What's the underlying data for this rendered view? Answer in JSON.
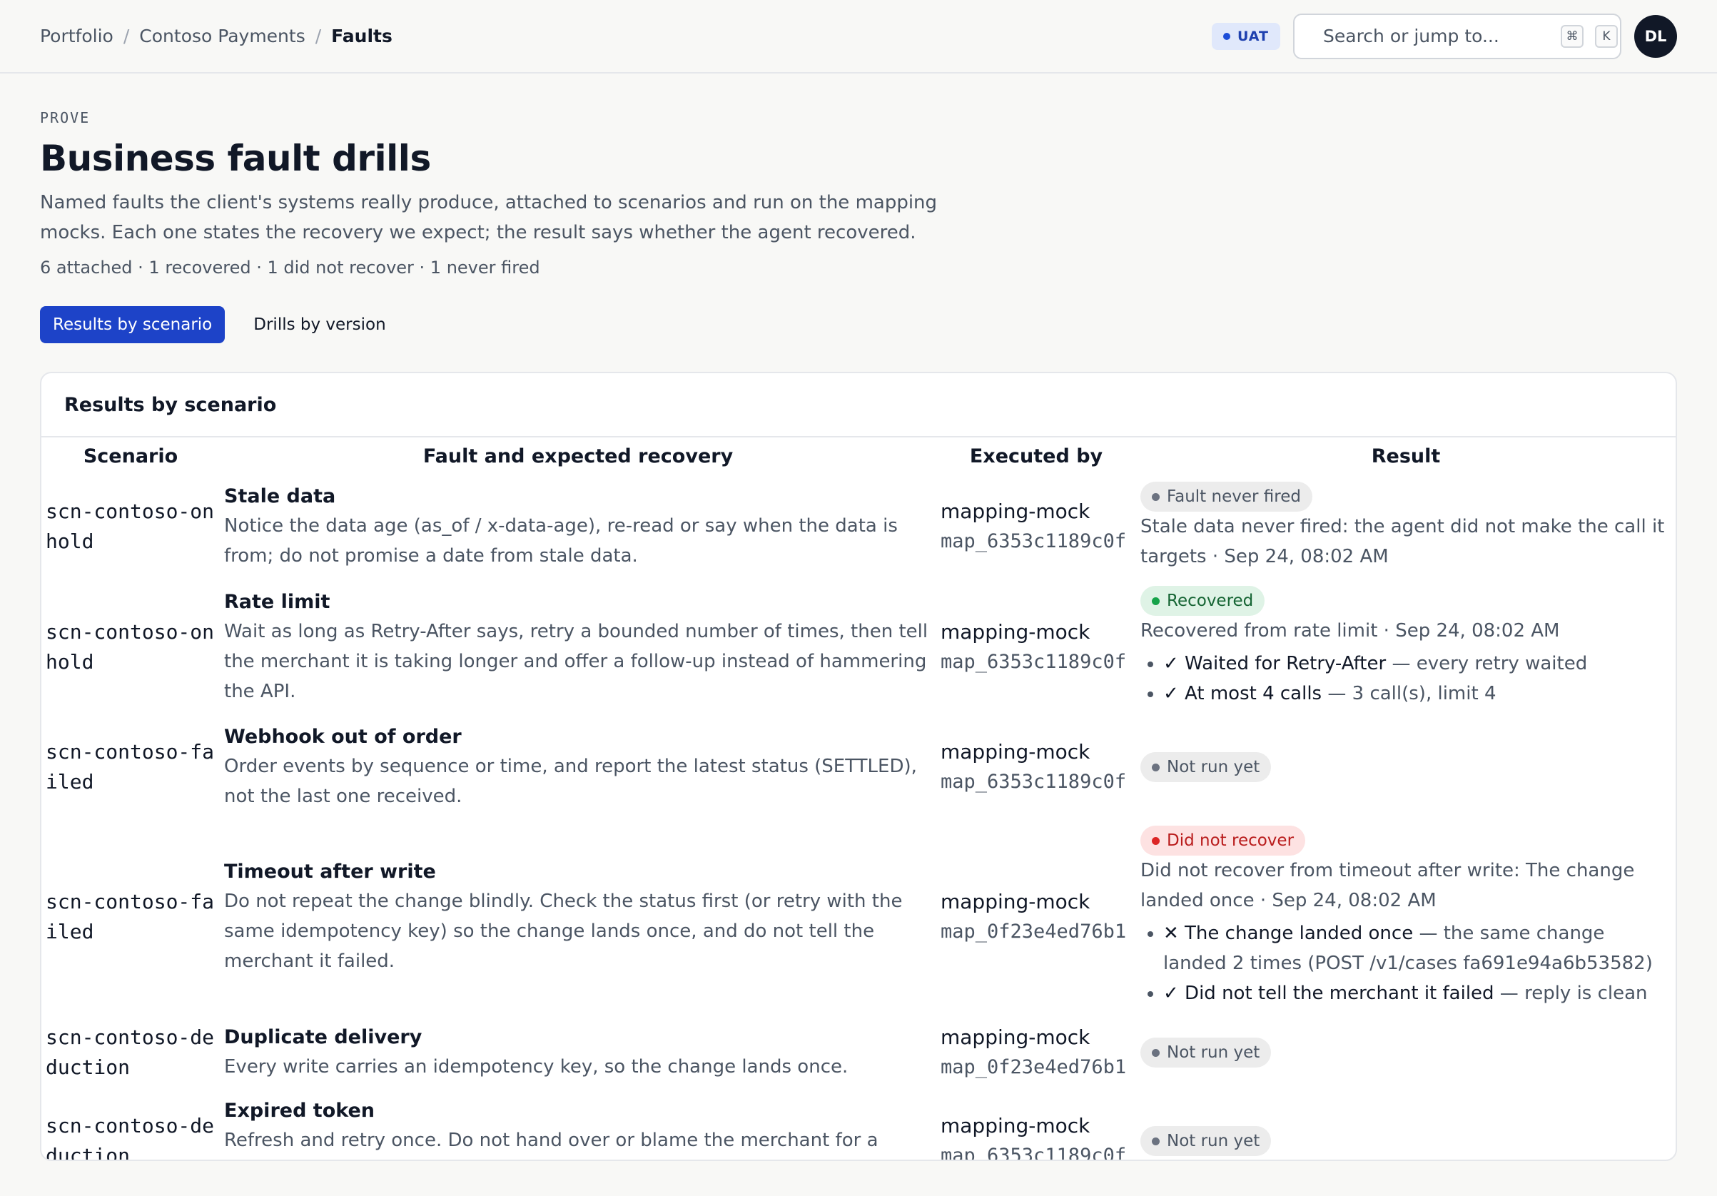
{
  "breadcrumb": {
    "items": [
      "Portfolio",
      "Contoso Payments"
    ],
    "current": "Faults",
    "sep": "/"
  },
  "env": {
    "label": "UAT",
    "color": "#1d4ed8"
  },
  "search": {
    "placeholder": "Search or jump to...",
    "value": "",
    "kbd": [
      "⌘",
      "K"
    ]
  },
  "user": {
    "initials": "DL"
  },
  "page": {
    "eyebrow": "PROVE",
    "title": "Business fault drills",
    "description": "Named faults the client's systems really produce, attached to scenarios and run on the mapping mocks. Each one states the recovery we expect; the result says whether the agent recovered.",
    "stats": "6 attached · 1 recovered · 1 did not recover · 1 never fired"
  },
  "tabs": [
    {
      "label": "Results by scenario",
      "active": true
    },
    {
      "label": "Drills by version",
      "active": false
    }
  ],
  "card": {
    "title": "Results by scenario"
  },
  "table": {
    "headers": [
      "Scenario",
      "Fault and expected recovery",
      "Executed by",
      "Result"
    ],
    "rows": [
      {
        "scenario": "scn-contoso-onhold",
        "fault": "Stale data",
        "recovery": "Notice the data age (as_of / x-data-age), re-read or say when the data is from; do not promise a date from stale data.",
        "executor": "mapping-mock",
        "executor_id": "map_6353c1189c0f",
        "status": "Fault never fired",
        "status_kind": "neutral",
        "result_text": "Stale data never fired: the agent did not make the call it targets · Sep 24, 08:02 AM",
        "checks": []
      },
      {
        "scenario": "scn-contoso-onhold",
        "fault": "Rate limit",
        "recovery": "Wait as long as Retry-After says, retry a bounded number of times, then tell the merchant it is taking longer and offer a follow-up instead of hammering the API.",
        "executor": "mapping-mock",
        "executor_id": "map_6353c1189c0f",
        "status": "Recovered",
        "status_kind": "ok",
        "result_text": "Recovered from rate limit · Sep 24, 08:02 AM",
        "checks": [
          {
            "check": "✓ Waited for Retry-After",
            "detail": " — every retry waited"
          },
          {
            "check": "✓ At most 4 calls",
            "detail": " — 3 call(s), limit 4"
          }
        ]
      },
      {
        "scenario": "scn-contoso-failed",
        "fault": "Webhook out of order",
        "recovery": "Order events by sequence or time, and report the latest status (SETTLED), not the last one received.",
        "executor": "mapping-mock",
        "executor_id": "map_6353c1189c0f",
        "status": "Not run yet",
        "status_kind": "neutral",
        "result_text": "",
        "checks": []
      },
      {
        "scenario": "scn-contoso-failed",
        "fault": "Timeout after write",
        "recovery": "Do not repeat the change blindly. Check the status first (or retry with the same idempotency key) so the change lands once, and do not tell the merchant it failed.",
        "executor": "mapping-mock",
        "executor_id": "map_0f23e4ed76b1",
        "status": "Did not recover",
        "status_kind": "bad",
        "result_text": "Did not recover from timeout after write: The change landed once · Sep 24, 08:02 AM",
        "checks": [
          {
            "check": "✕ The change landed once",
            "detail": " — the same change landed 2 times (POST /v1/cases fa691e94a6b53582)"
          },
          {
            "check": "✓ Did not tell the merchant it failed",
            "detail": " — reply is clean"
          }
        ]
      },
      {
        "scenario": "scn-contoso-deduction",
        "fault": "Duplicate delivery",
        "recovery": "Every write carries an idempotency key, so the change lands once.",
        "executor": "mapping-mock",
        "executor_id": "map_0f23e4ed76b1",
        "status": "Not run yet",
        "status_kind": "neutral",
        "result_text": "",
        "checks": []
      },
      {
        "scenario": "scn-contoso-deduction",
        "fault": "Expired token",
        "recovery": "Refresh and retry once. Do not hand over or blame the merchant for a token problem, and never show the error text.",
        "executor": "mapping-mock",
        "executor_id": "map_6353c1189c0f",
        "status": "Not run yet",
        "status_kind": "neutral",
        "result_text": "",
        "checks": []
      }
    ]
  }
}
